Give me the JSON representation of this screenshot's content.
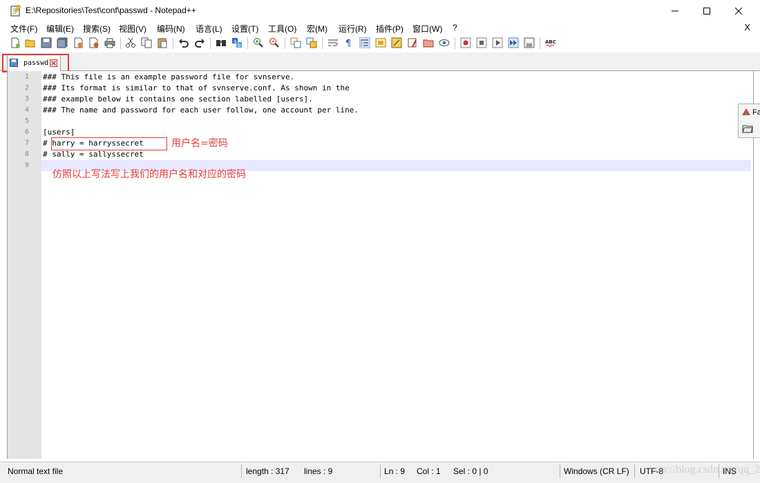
{
  "window": {
    "title": "E:\\Repositories\\Test\\conf\\passwd - Notepad++",
    "icon": "notepad-plus-plus-icon"
  },
  "menu": {
    "items": [
      "文件(F)",
      "编辑(E)",
      "搜索(S)",
      "视图(V)",
      "编码(N)",
      "语言(L)",
      "设置(T)",
      "工具(O)",
      "宏(M)",
      "运行(R)",
      "插件(P)",
      "窗口(W)",
      "?"
    ],
    "close_label": "X"
  },
  "toolbar": {
    "icons": [
      "new-file-icon",
      "open-file-icon",
      "save-icon",
      "save-all-icon",
      "close-icon",
      "close-all-icon",
      "print-icon",
      "cut-icon",
      "copy-icon",
      "paste-icon",
      "undo-icon",
      "redo-icon",
      "find-icon",
      "replace-icon",
      "zoom-in-icon",
      "zoom-out-icon",
      "sync-vertical-icon",
      "sync-horizontal-icon",
      "word-wrap-icon",
      "show-all-chars-icon",
      "indent-guide-icon",
      "doc-map-icon",
      "function-list-icon",
      "folder-as-workspace-icon",
      "monitoring-icon",
      "record-macro-icon",
      "stop-macro-icon",
      "play-macro-icon",
      "run-macro-multiple-icon",
      "save-macro-icon",
      "spell-check-icon"
    ]
  },
  "tabs": [
    {
      "label": "passwd",
      "active": true
    }
  ],
  "editor": {
    "lines": [
      "### This file is an example password file for svnserve.",
      "### Its format is similar to that of svnserve.conf. As shown in the",
      "### example below it contains one section labelled [users].",
      "### The name and password for each user follow, one account per line.",
      "",
      "[users]",
      "# harry = harryssecret",
      "# sally = sallyssecret",
      ""
    ],
    "line_numbers": [
      "1",
      "2",
      "3",
      "4",
      "5",
      "6",
      "7",
      "8",
      "9"
    ],
    "current_line": 9
  },
  "annotations": {
    "note1": "用户名=密码",
    "note2": "仿照以上写法写上我们的用户名和对应的密码",
    "color": "#e53935"
  },
  "float_panel": {
    "label": "Fa"
  },
  "status": {
    "file_type": "Normal text file",
    "length": "length : 317",
    "lines": "lines : 9",
    "ln": "Ln : 9",
    "col": "Col : 1",
    "sel": "Sel : 0 | 0",
    "eol": "Windows (CR LF)",
    "encoding": "UTF-8",
    "mode": "INS"
  },
  "watermark": "http://blog.csdn.net/qq_25345657"
}
